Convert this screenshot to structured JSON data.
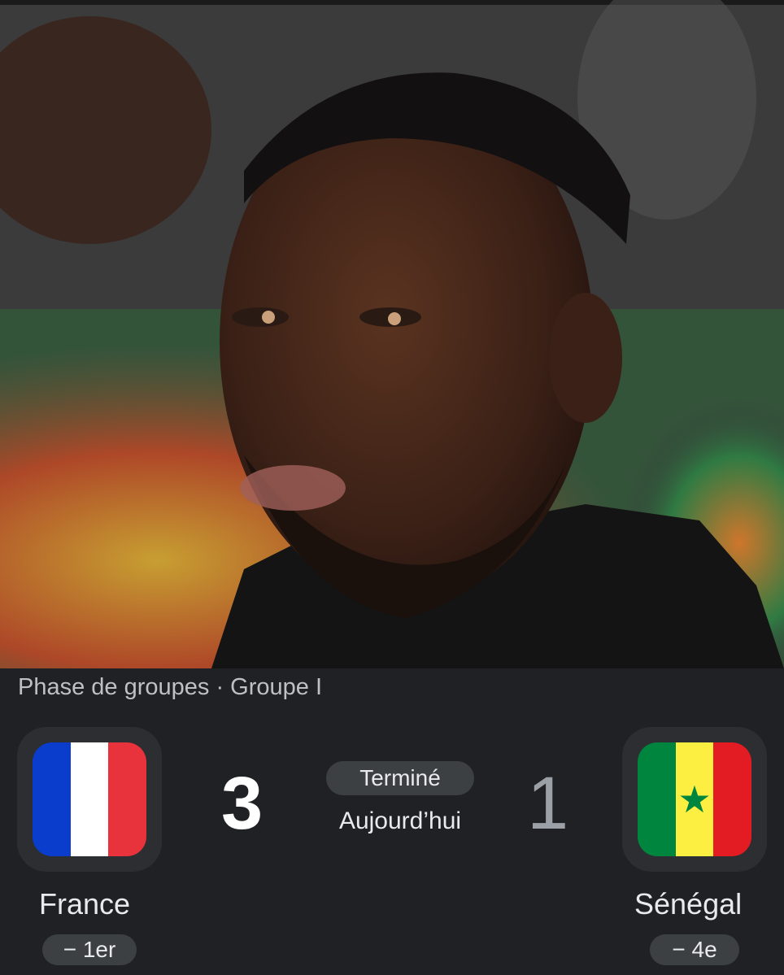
{
  "photo": {
    "subject": "man-portrait-photo"
  },
  "match": {
    "phase": "Phase de groupes · Groupe I",
    "status": "Terminé",
    "date": "Aujourd’hui",
    "home": {
      "name": "France",
      "score": "3",
      "rank": "− 1er",
      "flag_colors": [
        "#0a3dcc",
        "#ffffff",
        "#e8323c"
      ]
    },
    "away": {
      "name": "Sénégal",
      "score": "1",
      "rank": "− 4e",
      "flag_colors": [
        "#00853f",
        "#fdef42",
        "#e31b23"
      ],
      "flag_star": "★"
    }
  }
}
